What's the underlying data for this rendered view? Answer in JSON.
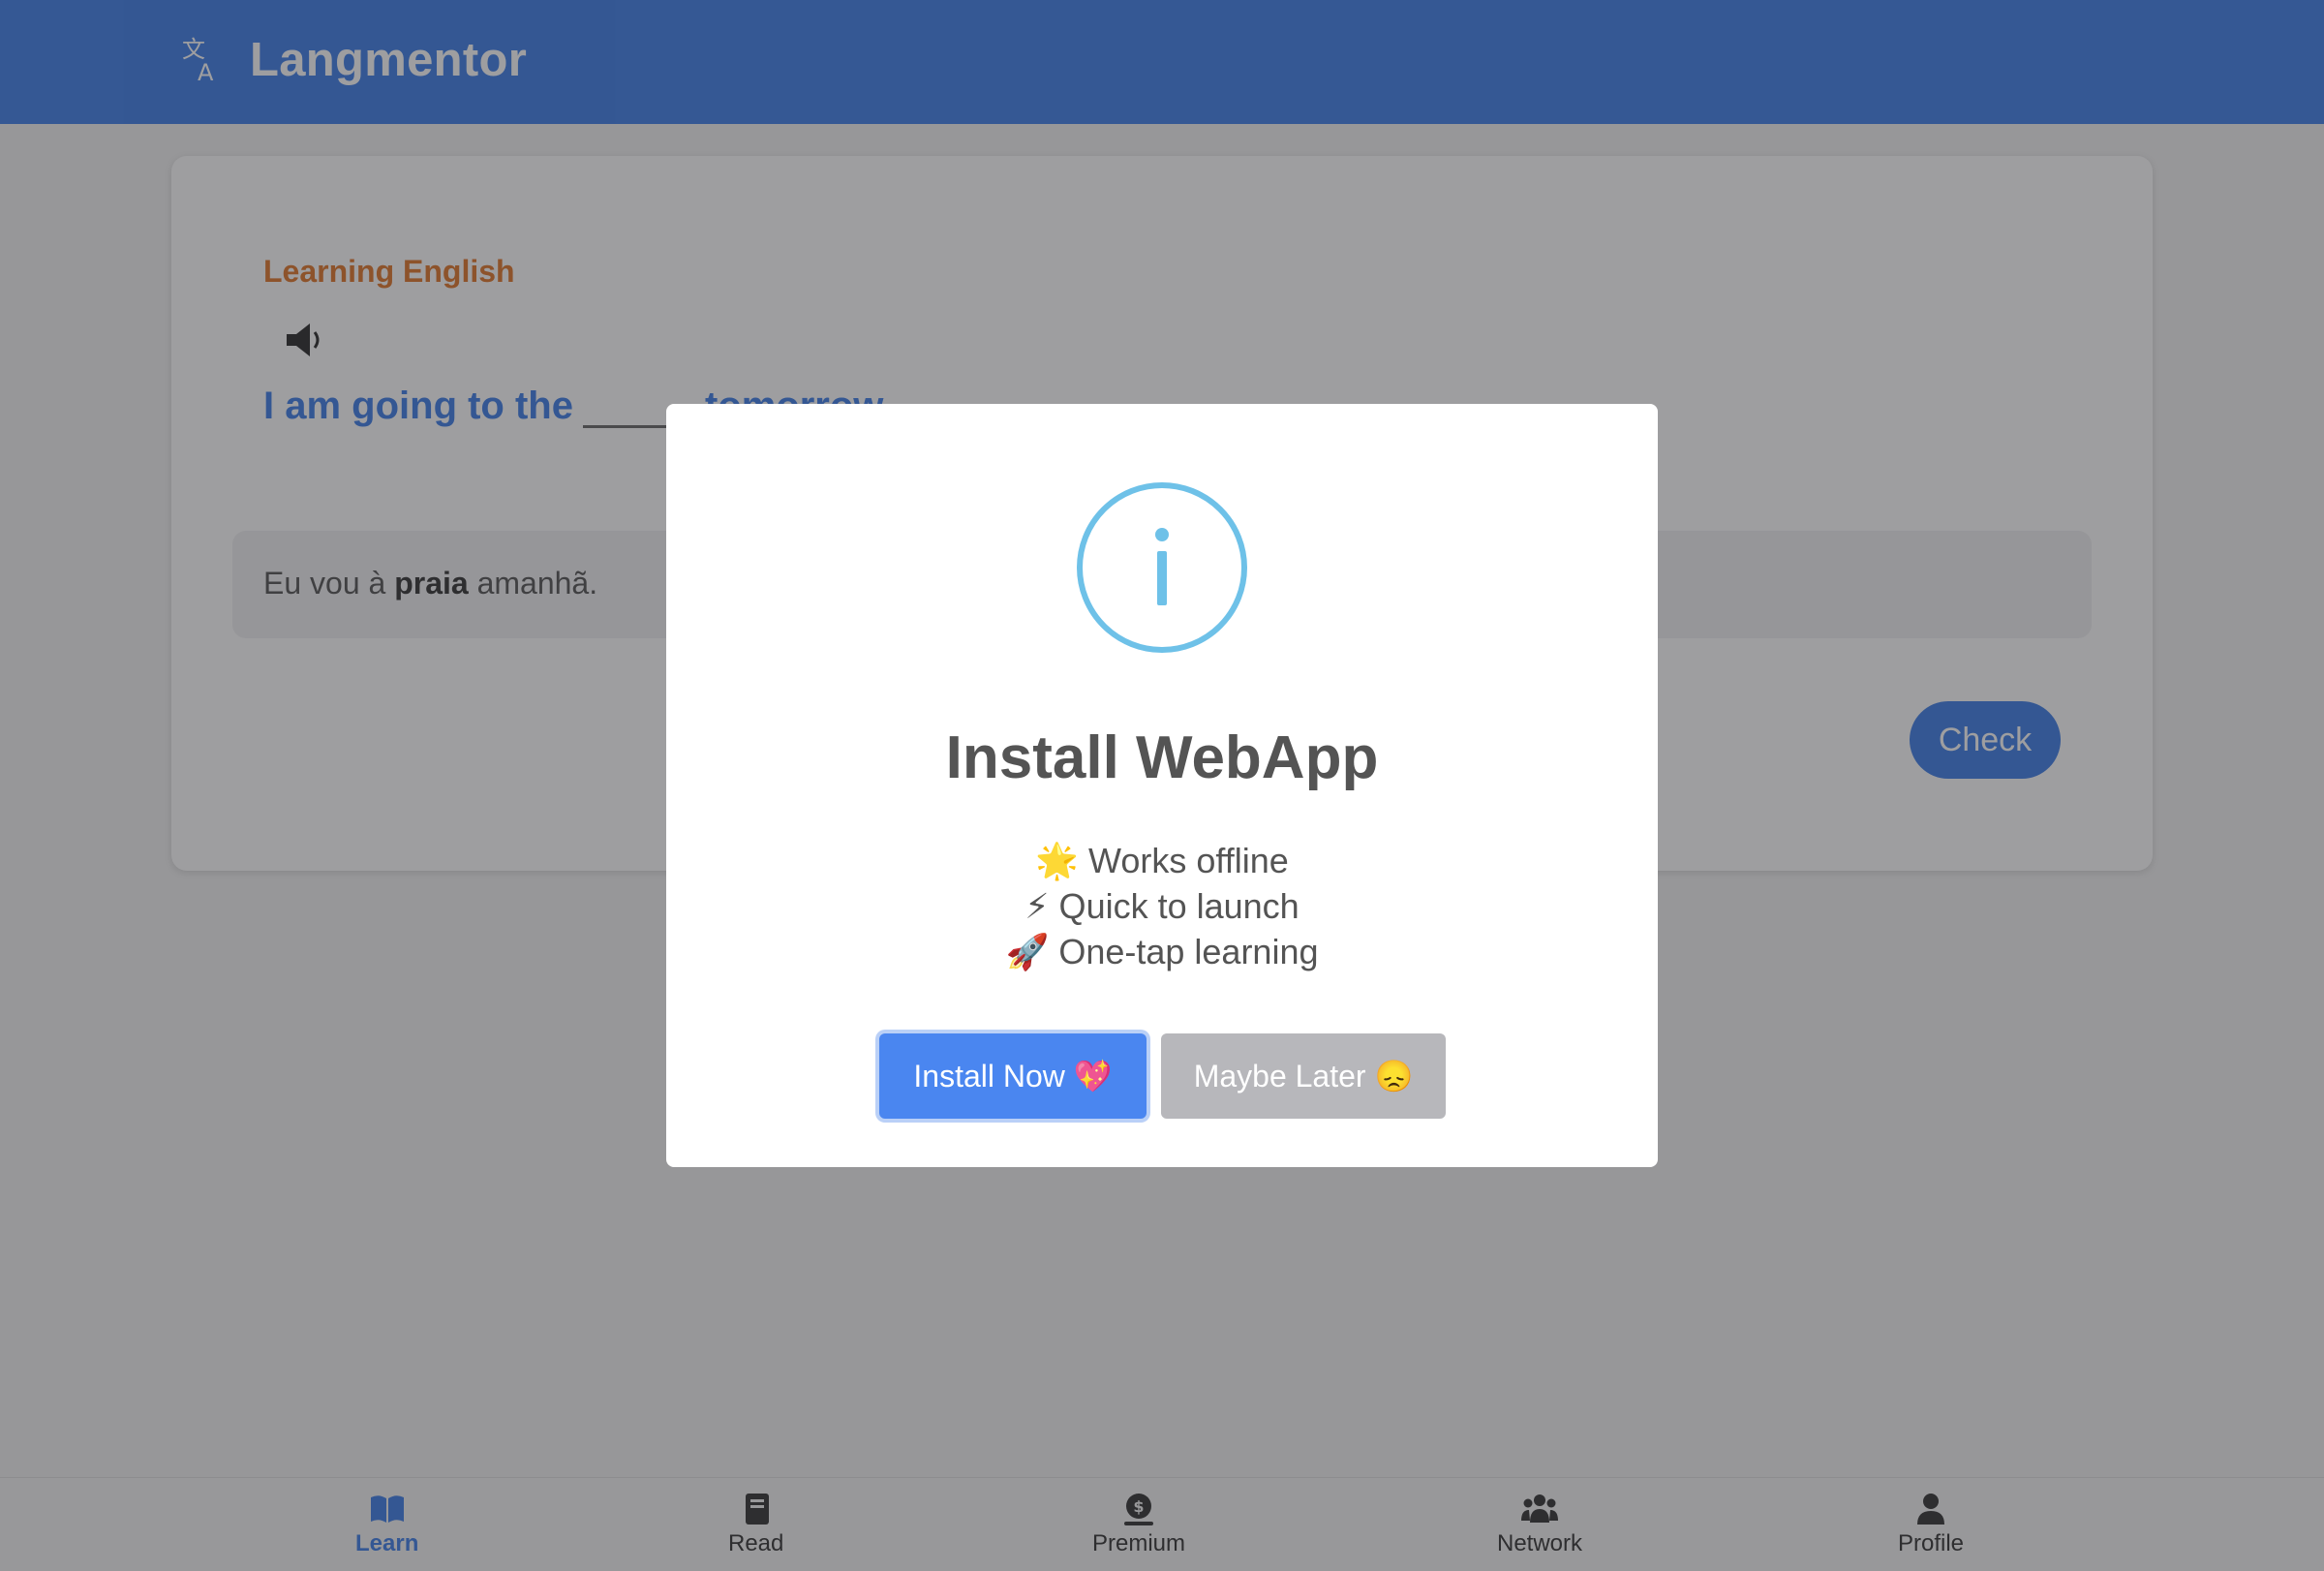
{
  "app": {
    "title": "Langmentor",
    "icon": "translate-icon",
    "brand_color": "#3f7fe8"
  },
  "lesson": {
    "language_label": "Learning English",
    "audio_icon": "speaker-icon",
    "sentence_before": "I am going to the",
    "sentence_after": "tomorrow",
    "hint_before": "Eu vou à ",
    "hint_bold": "praia",
    "hint_after": " amanhã.",
    "check_label": "Check"
  },
  "modal": {
    "icon": "info-icon",
    "icon_color": "#6ec1e8",
    "title": "Install WebApp",
    "features": [
      "🌟 Works offline",
      "⚡ Quick to launch",
      "🚀 One-tap learning"
    ],
    "install_label": "Install Now 💖",
    "later_label": "Maybe Later 😞"
  },
  "nav": {
    "items": [
      {
        "label": "Learn",
        "icon": "book-open-icon",
        "active": true
      },
      {
        "label": "Read",
        "icon": "book-icon",
        "active": false
      },
      {
        "label": "Premium",
        "icon": "dollar-icon",
        "active": false
      },
      {
        "label": "Network",
        "icon": "users-icon",
        "active": false
      },
      {
        "label": "Profile",
        "icon": "user-icon",
        "active": false
      }
    ]
  }
}
